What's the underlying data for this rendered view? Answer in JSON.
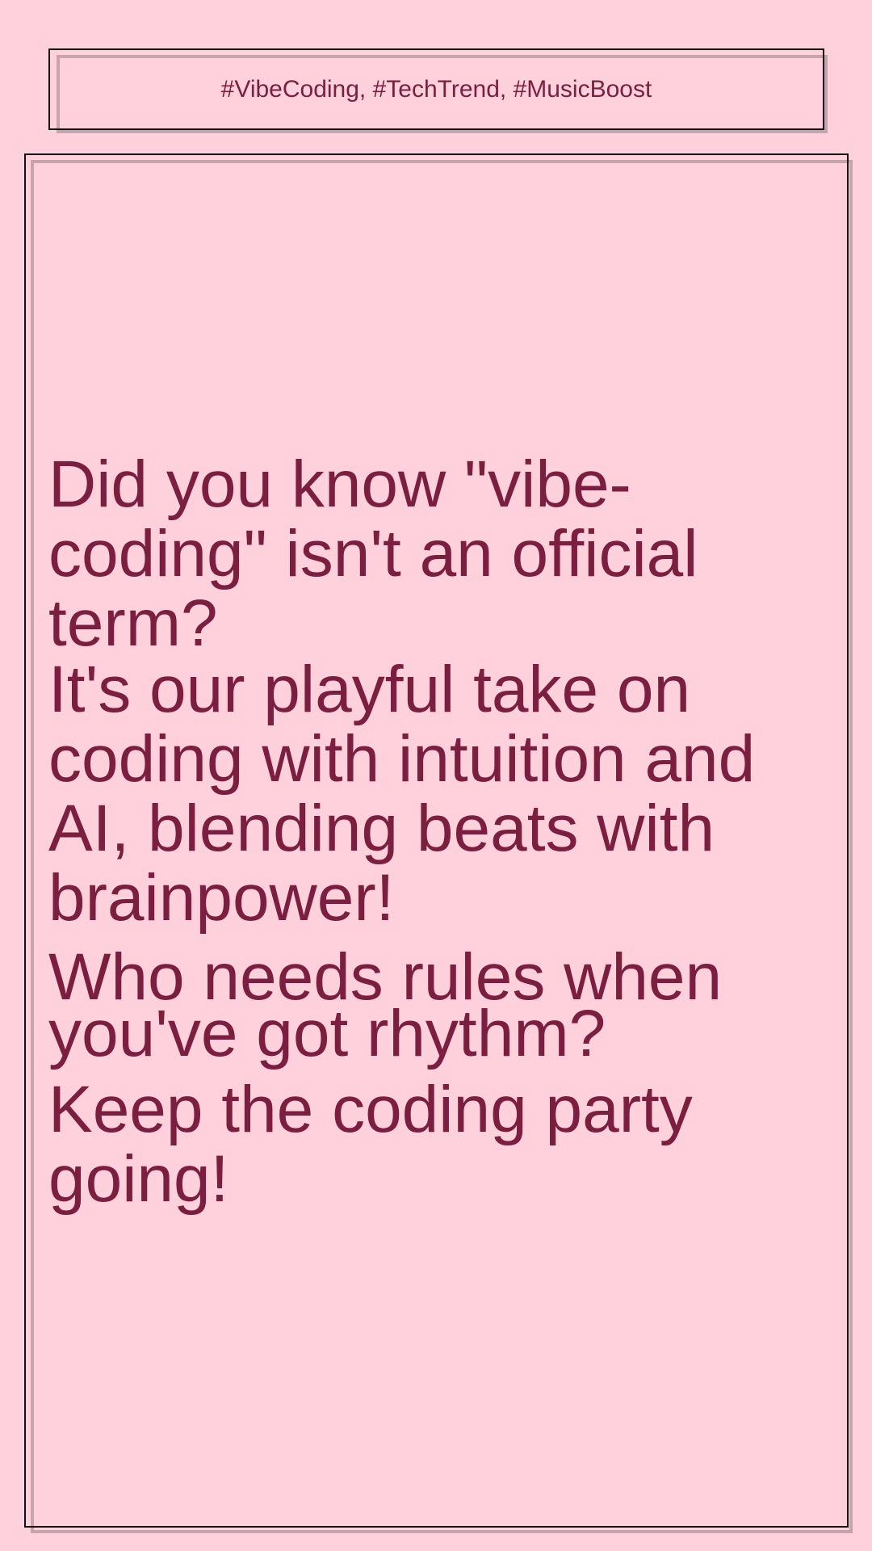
{
  "post": {
    "hashtags": "#VibeCoding, #TechTrend, #MusicBoost",
    "lines": [
      "Did you know \"vibe-coding\" isn't an official term?",
      "It's our playful take on coding with intuition and AI, blending beats with brainpower!",
      "Who needs rules when you've got rhythm?",
      "Keep the coding party going!"
    ]
  },
  "colors": {
    "background": "#ffd1dc",
    "text": "#7b1e3f",
    "border": "#111111",
    "border_shadow": "#c7a3ad"
  }
}
